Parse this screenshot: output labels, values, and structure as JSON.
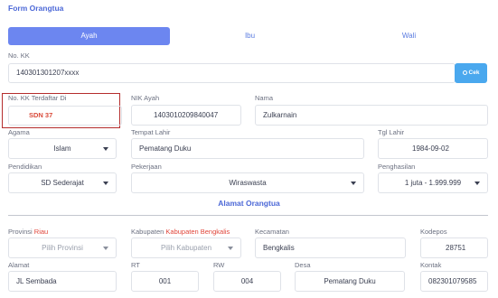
{
  "form_title": "Form Orangtua",
  "tabs": [
    "Ayah",
    "Ibu",
    "Wali"
  ],
  "no_kk": {
    "label": "No. KK",
    "value": "140301301207xxxx",
    "button": "Cek"
  },
  "no_kk_terdaftar": {
    "label": "No. KK Terdaftar Di",
    "value": "SDN 37"
  },
  "nik_ayah": {
    "label": "NIK Ayah",
    "value": "1403010209840047"
  },
  "nama": {
    "label": "Nama",
    "value": "Zulkarnain"
  },
  "agama": {
    "label": "Agama",
    "value": "Islam"
  },
  "tempat_lahir": {
    "label": "Tempat Lahir",
    "value": "Pematang Duku"
  },
  "tgl_lahir": {
    "label": "Tgl Lahir",
    "value": "1984-09-02"
  },
  "pendidikan": {
    "label": "Pendidikan",
    "value": "SD Sederajat"
  },
  "pekerjaan": {
    "label": "Pekerjaan",
    "value": "Wiraswasta"
  },
  "penghasilan": {
    "label": "Penghasilan",
    "value": "1 juta - 1.999.999"
  },
  "alamat_section": "Alamat Orangtua",
  "provinsi": {
    "label": "Provinsi",
    "label_value": "Riau",
    "placeholder": "Pilih Provinsi"
  },
  "kabupaten": {
    "label": "Kabupaten",
    "label_value": "Kabupaten Bengkalis",
    "placeholder": "Pilih Kabupaten"
  },
  "kecamatan": {
    "label": "Kecamatan",
    "value": "Bengkalis"
  },
  "kodepos": {
    "label": "Kodepos",
    "value": "28751"
  },
  "alamat": {
    "label": "Alamat",
    "value": "JL Sembada"
  },
  "rt": {
    "label": "RT",
    "value": "001"
  },
  "rw": {
    "label": "RW",
    "value": "004"
  },
  "desa": {
    "label": "Desa",
    "value": "Pematang Duku"
  },
  "kontak": {
    "label": "Kontak",
    "value": "082301079585"
  },
  "colors": {
    "accent": "#4c68d7",
    "tab_active": "#6c86f0",
    "button": "#4aa8ee",
    "required": "#e0453a",
    "highlight_border": "#b52d2d"
  }
}
